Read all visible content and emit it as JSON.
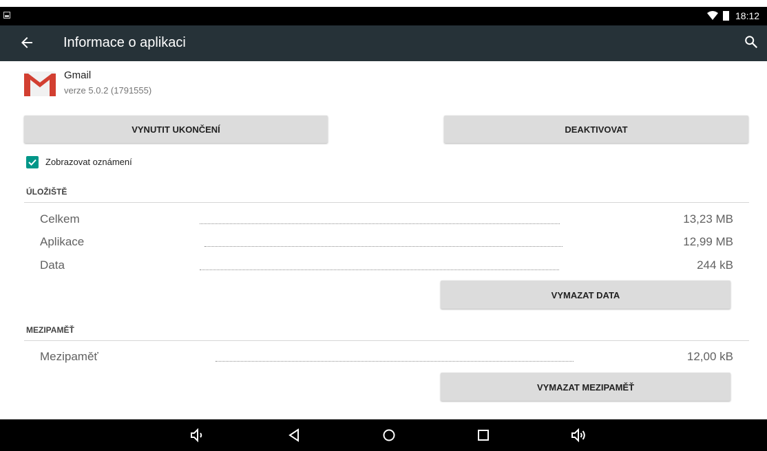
{
  "status_bar": {
    "time": "18:12"
  },
  "app_bar": {
    "title": "Informace o aplikaci"
  },
  "app": {
    "name": "Gmail",
    "version": "verze 5.0.2 (1791555)"
  },
  "buttons": {
    "force_stop": "VYNUTIT UKONČENÍ",
    "disable": "DEAKTIVOVAT",
    "clear_data": "VYMAZAT DATA",
    "clear_cache": "VYMAZAT MEZIPAMĚŤ"
  },
  "notifications": {
    "label": "Zobrazovat oznámení",
    "checked": true
  },
  "storage": {
    "heading": "ÚLOŽIŠTĚ",
    "rows": [
      {
        "label": "Celkem",
        "value": "13,23 MB"
      },
      {
        "label": "Aplikace",
        "value": "12,99 MB"
      },
      {
        "label": "Data",
        "value": "244 kB"
      }
    ]
  },
  "cache": {
    "heading": "MEZIPAMĚŤ",
    "rows": [
      {
        "label": "Mezipaměť",
        "value": "12,00 kB"
      }
    ]
  },
  "colors": {
    "app_bar": "#263238",
    "accent": "#009688",
    "button": "#dcdcdc"
  }
}
